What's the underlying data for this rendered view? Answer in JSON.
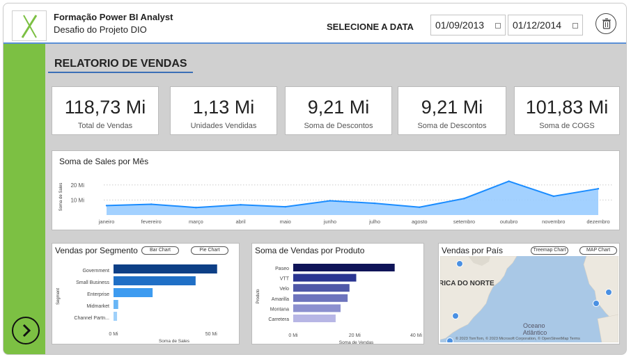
{
  "header": {
    "title": "Formação Power BI Analyst",
    "subtitle": "Desafio do Projeto DIO",
    "select_date_label": "SELECIONE A DATA",
    "date_start": "01/09/2013",
    "date_end": "01/12/2014"
  },
  "report": {
    "title": "RELATORIO DE VENDAS"
  },
  "kpis": [
    {
      "value": "118,73 Mi",
      "label": "Total de Vendas"
    },
    {
      "value": "1,13 Mi",
      "label": "Unidades Vendidas"
    },
    {
      "value": "9,21 Mi",
      "label": "Soma de Descontos"
    },
    {
      "value": "9,21 Mi",
      "label": "Soma de Descontos"
    },
    {
      "value": "101,83 Mi",
      "label": "Soma de COGS"
    }
  ],
  "line_panel": {
    "title": "Soma de Sales por Mês"
  },
  "segment_panel": {
    "title": "Vendas por Segmento",
    "pill_1": "Bar Chart",
    "pill_2": "Pie Chart"
  },
  "product_panel": {
    "title": "Soma de Vendas por Produto"
  },
  "map_panel": {
    "title": "Vendas por País",
    "pill_1": "Treemap Chart",
    "pill_2": "MAP Chart",
    "label_na": "RICA DO NORTE",
    "label_ocean": "Oceano\nAtlântico",
    "copyright": "© 2023 TomTom, © 2023 Microsoft Corporation, © OpenStreetMap  Terms",
    "points_color": "#4a90e2"
  },
  "colors": {
    "accent": "#7cc043",
    "line_fill": "#99ccff",
    "line_stroke": "#1a8cff"
  },
  "chart_data": [
    {
      "type": "area",
      "title": "Soma de Sales por Mês",
      "ylabel": "Soma de Sales",
      "categories": [
        "janeiro",
        "fevereiro",
        "março",
        "abril",
        "maio",
        "junho",
        "julho",
        "agosto",
        "setembro",
        "outubro",
        "novembro",
        "dezembro"
      ],
      "values": [
        6.3,
        7.2,
        5.0,
        6.8,
        5.5,
        9.5,
        7.8,
        5.2,
        11.0,
        22.5,
        12.5,
        17.5
      ],
      "yticks": [
        10,
        20
      ],
      "ytick_labels": [
        "10 Mi",
        "20 Mi"
      ],
      "ylim": [
        0,
        25
      ],
      "grid": true
    },
    {
      "type": "bar",
      "title": "Vendas por Segmento",
      "orientation": "horizontal",
      "categories": [
        "Government",
        "Small Business",
        "Enterprise",
        "Midmarket",
        "Channel Partn..."
      ],
      "values": [
        53,
        42,
        20,
        2.4,
        1.8
      ],
      "colors": [
        "#0d3f86",
        "#1f6fc6",
        "#3d9bf0",
        "#68b6f6",
        "#9fd0fa"
      ],
      "xlabel": "Soma de Sales",
      "ylabel": "Segment",
      "xticks": [
        0,
        50
      ],
      "xtick_labels": [
        "0 Mi",
        "50 Mi"
      ],
      "xlim": [
        0,
        62
      ]
    },
    {
      "type": "bar",
      "title": "Soma de Vendas por Produto",
      "orientation": "horizontal",
      "categories": [
        "Paseo",
        "VTT",
        "Velo",
        "Amarilla",
        "Montana",
        "Carretera"
      ],
      "values": [
        33.0,
        20.5,
        18.3,
        17.7,
        15.4,
        13.8
      ],
      "colors": [
        "#0f1458",
        "#2a3591",
        "#4f58a8",
        "#6d74bd",
        "#8c90cf",
        "#b7b6e5"
      ],
      "xlabel": "Soma de Vendas",
      "ylabel": "Produto",
      "xticks": [
        0,
        20,
        40
      ],
      "xtick_labels": [
        "0 Mi",
        "20 Mi",
        "40 Mi"
      ],
      "xlim": [
        0,
        41
      ]
    }
  ]
}
